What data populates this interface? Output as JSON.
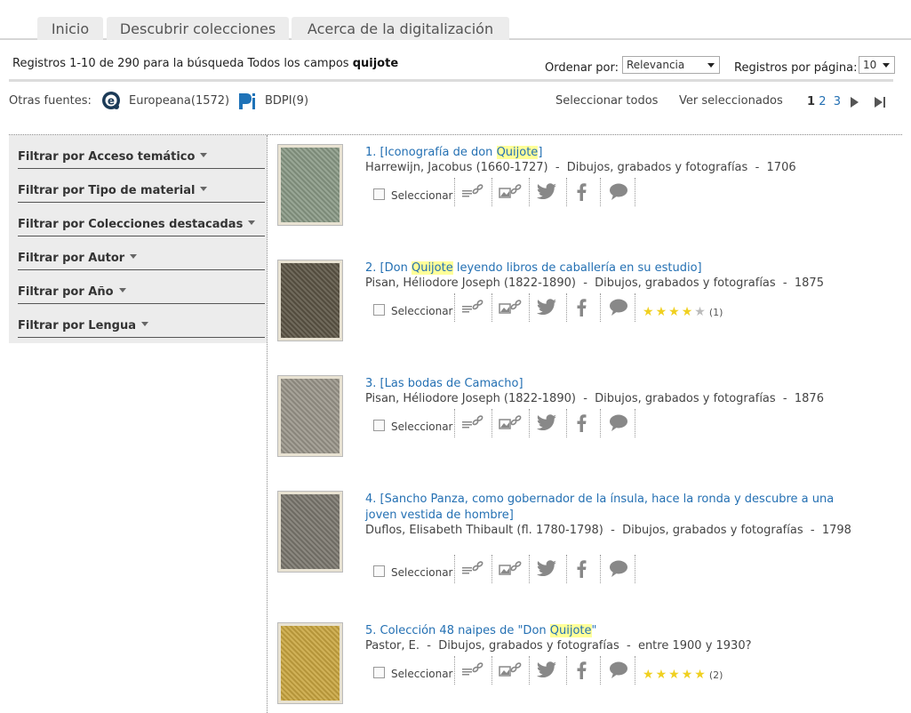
{
  "tabs": [
    {
      "label": "Inicio"
    },
    {
      "label": "Descubrir colecciones"
    },
    {
      "label": "Acerca de la digitalización"
    }
  ],
  "summary": {
    "prefix": "Registros 1-10 de 290 para la búsqueda Todos los campos ",
    "term": "quijote"
  },
  "sort": {
    "label": "Ordenar por:",
    "value": "Relevancia"
  },
  "per_page": {
    "label": "Registros por página:",
    "value": "10"
  },
  "sources": {
    "label": "Otras fuentes:",
    "items": [
      {
        "name": "Europeana(1572)"
      },
      {
        "name": "BDPI(9)"
      }
    ]
  },
  "toolbar": {
    "select_all": "Seleccionar todos",
    "view_selected": "Ver seleccionados"
  },
  "pagination": {
    "pages": [
      "1",
      "2",
      "3"
    ],
    "current": "1"
  },
  "filters": [
    {
      "label": "Filtrar por Acceso temático"
    },
    {
      "label": "Filtrar por Tipo de material"
    },
    {
      "label": "Filtrar por Colecciones destacadas"
    },
    {
      "label": "Filtrar por Autor"
    },
    {
      "label": "Filtrar por Año"
    },
    {
      "label": "Filtrar por Lengua"
    }
  ],
  "select_label": "Seleccionar",
  "icons": [
    "text-link-icon",
    "image-link-icon",
    "twitter-icon",
    "facebook-icon",
    "comment-icon"
  ],
  "results": [
    {
      "num": "1.",
      "title_pre": "[Iconografía de don ",
      "title_hl": "Quijote",
      "title_post": "]",
      "meta": "Harrewijn, Jacobus (1660-1727)  -  Dibujos, grabados y fotografías  -  1706",
      "rating": null,
      "rating_count": null
    },
    {
      "num": "2.",
      "title_pre": "[Don ",
      "title_hl": "Quijote",
      "title_post": " leyendo libros de caballería en su estudio]",
      "meta": "Pisan, Héliodore Joseph (1822-1890)  -  Dibujos, grabados y fotografías  -  1875",
      "rating": 4,
      "rating_count": "(1)"
    },
    {
      "num": "3.",
      "title_pre": "[Las bodas de Camacho]",
      "title_hl": "",
      "title_post": "",
      "meta": "Pisan, Héliodore Joseph (1822-1890)  -  Dibujos, grabados y fotografías  -  1876",
      "rating": null,
      "rating_count": null
    },
    {
      "num": "4.",
      "title_pre": "[Sancho Panza, como gobernador de la ínsula, hace la ronda y descubre a una joven vestida de hombre]",
      "title_hl": "",
      "title_post": "",
      "meta": "Duflos, Elisabeth Thibault (fl. 1780-1798)  -  Dibujos, grabados y fotografías  -  1798",
      "rating": null,
      "rating_count": null
    },
    {
      "num": "5.",
      "title_pre": "Colección 48 naipes de \"Don ",
      "title_hl": "Quijote",
      "title_post": "\"",
      "meta": "Pastor, E.  -  Dibujos, grabados y fotografías  -  entre 1900 y 1930?",
      "rating": 5,
      "rating_count": "(2)"
    }
  ]
}
